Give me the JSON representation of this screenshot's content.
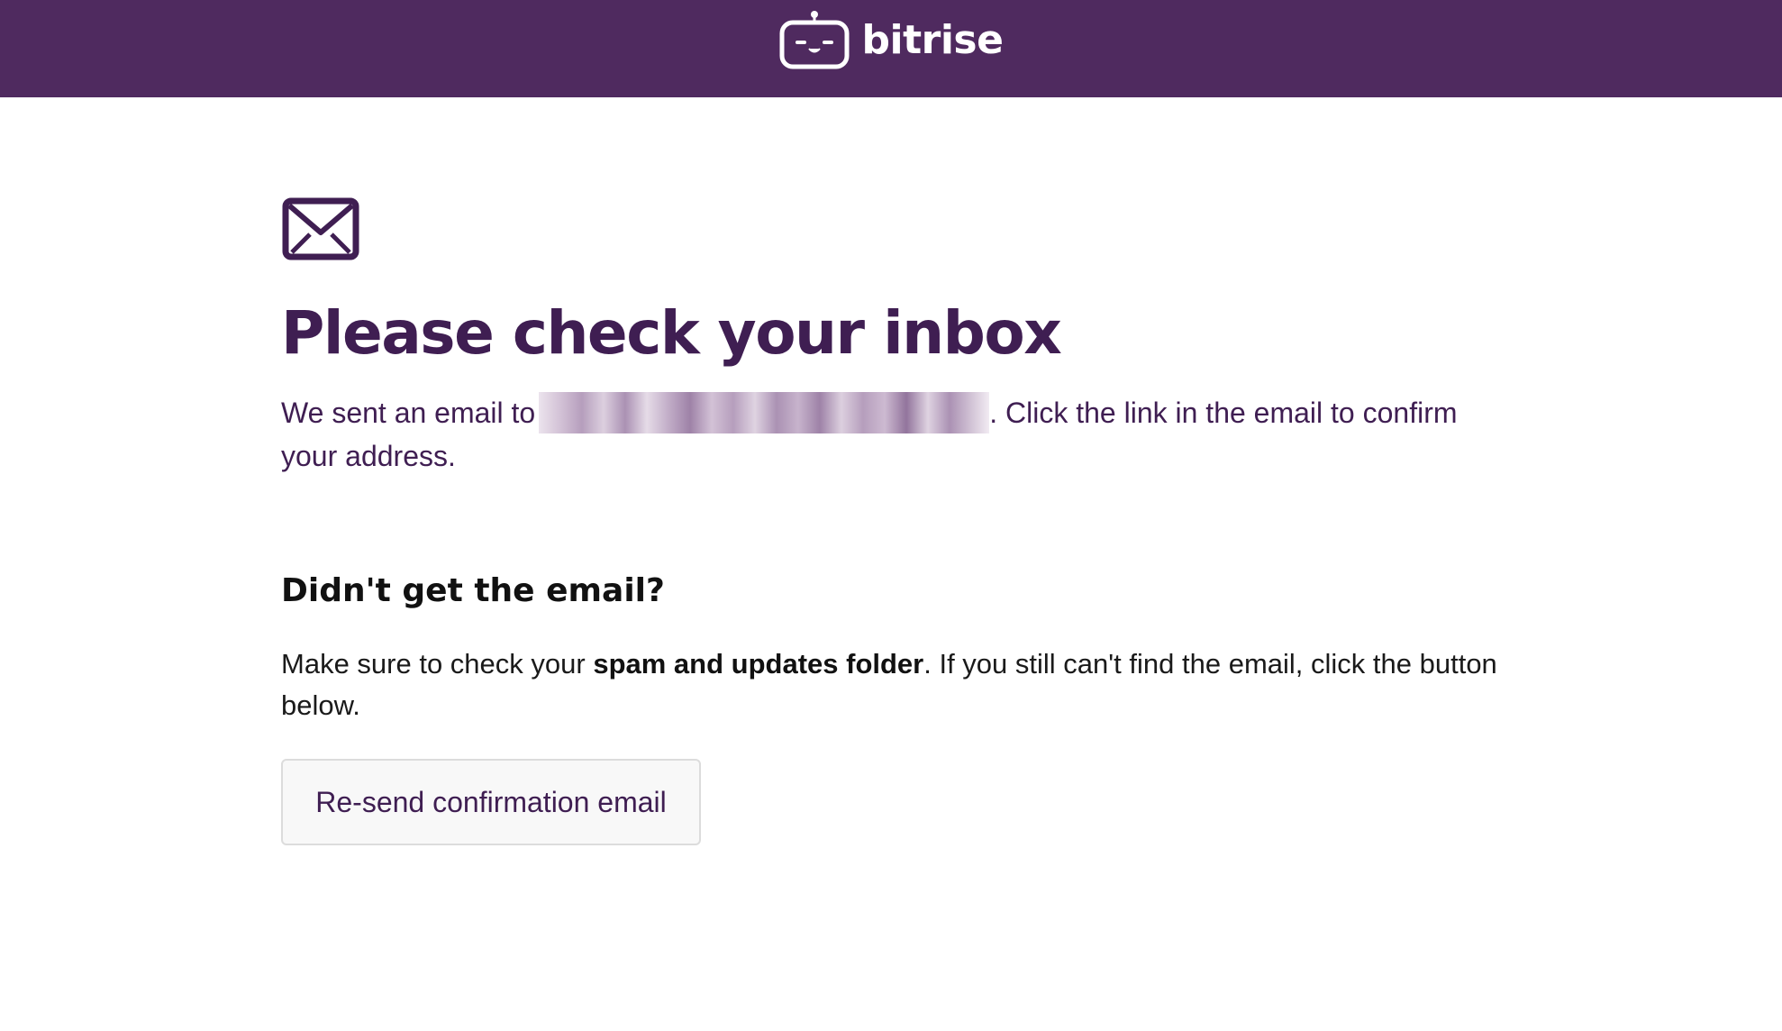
{
  "header": {
    "brand_name": "bitrise",
    "brand_icon": "bitrise-robot-icon",
    "background_color": "#4f2a5f"
  },
  "main": {
    "icon": "envelope-icon",
    "title": "Please check your inbox",
    "intro_prefix": "We sent an email to",
    "intro_suffix": ". Click the link in the email to confirm your address.",
    "help_heading": "Didn't get the email?",
    "help_before": "Make sure to check your ",
    "help_bold": "spam and updates folder",
    "help_after": ". If you still can't find the email, click the button below.",
    "resend_label": "Re-send confirmation email"
  },
  "colors": {
    "accent": "#3f1e52",
    "text": "#1a1a1a"
  }
}
